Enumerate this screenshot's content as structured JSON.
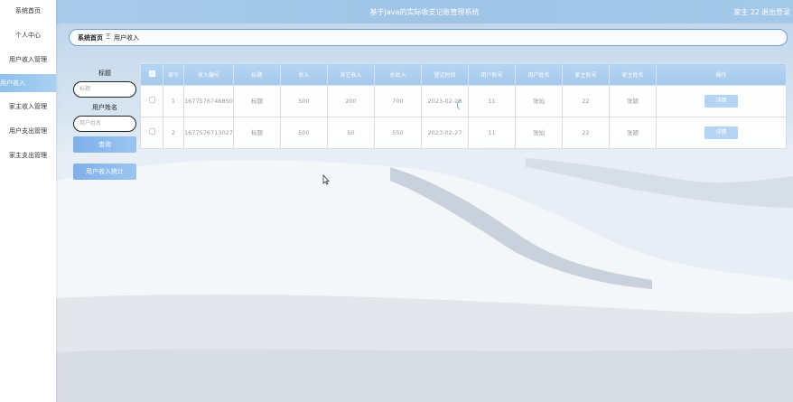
{
  "header": {
    "title": "基于Java的实际收支记账管理系统",
    "user": "家主 22",
    "logout": "退出登录"
  },
  "sidebar": {
    "items": [
      {
        "label": "系统首页"
      },
      {
        "label": "个人中心"
      },
      {
        "label": "用户收入管理"
      },
      {
        "label": "用户收入"
      },
      {
        "label": "家主收入管理"
      },
      {
        "label": "用户支出管理"
      },
      {
        "label": "家主支出管理"
      }
    ]
  },
  "breadcrumb": {
    "home": "系统首页",
    "separator": "Ξ",
    "current": "用户收入"
  },
  "search": {
    "title_label": "标题",
    "title_placeholder": "标题",
    "name_label": "用户姓名",
    "name_placeholder": "用户姓名",
    "query_button": "查询",
    "stats_button": "用户收入统计"
  },
  "table": {
    "headers": [
      "索引",
      "收入编号",
      "标题",
      "收入",
      "其它收入",
      "总收入",
      "登记时间",
      "用户账号",
      "用户姓名",
      "家主账号",
      "家主姓名",
      "操作"
    ],
    "rows": [
      {
        "index": "1",
        "no": "1677576746850",
        "title": "标题",
        "income": "500",
        "other": "200",
        "total": "700",
        "time": "2023-02-28",
        "account": "11",
        "name": "张灿",
        "host_account": "22",
        "host_name": "张颖",
        "action": "详情"
      },
      {
        "index": "2",
        "no": "1677576713027",
        "title": "标题",
        "income": "500",
        "other": "50",
        "total": "550",
        "time": "2023-02-27",
        "account": "11",
        "name": "张灿",
        "host_account": "22",
        "host_name": "张颖",
        "action": "详情"
      }
    ]
  },
  "colors": {
    "accent": "#9fc4e6",
    "button": "#8bb8ec",
    "border": "#6f9ed8"
  }
}
